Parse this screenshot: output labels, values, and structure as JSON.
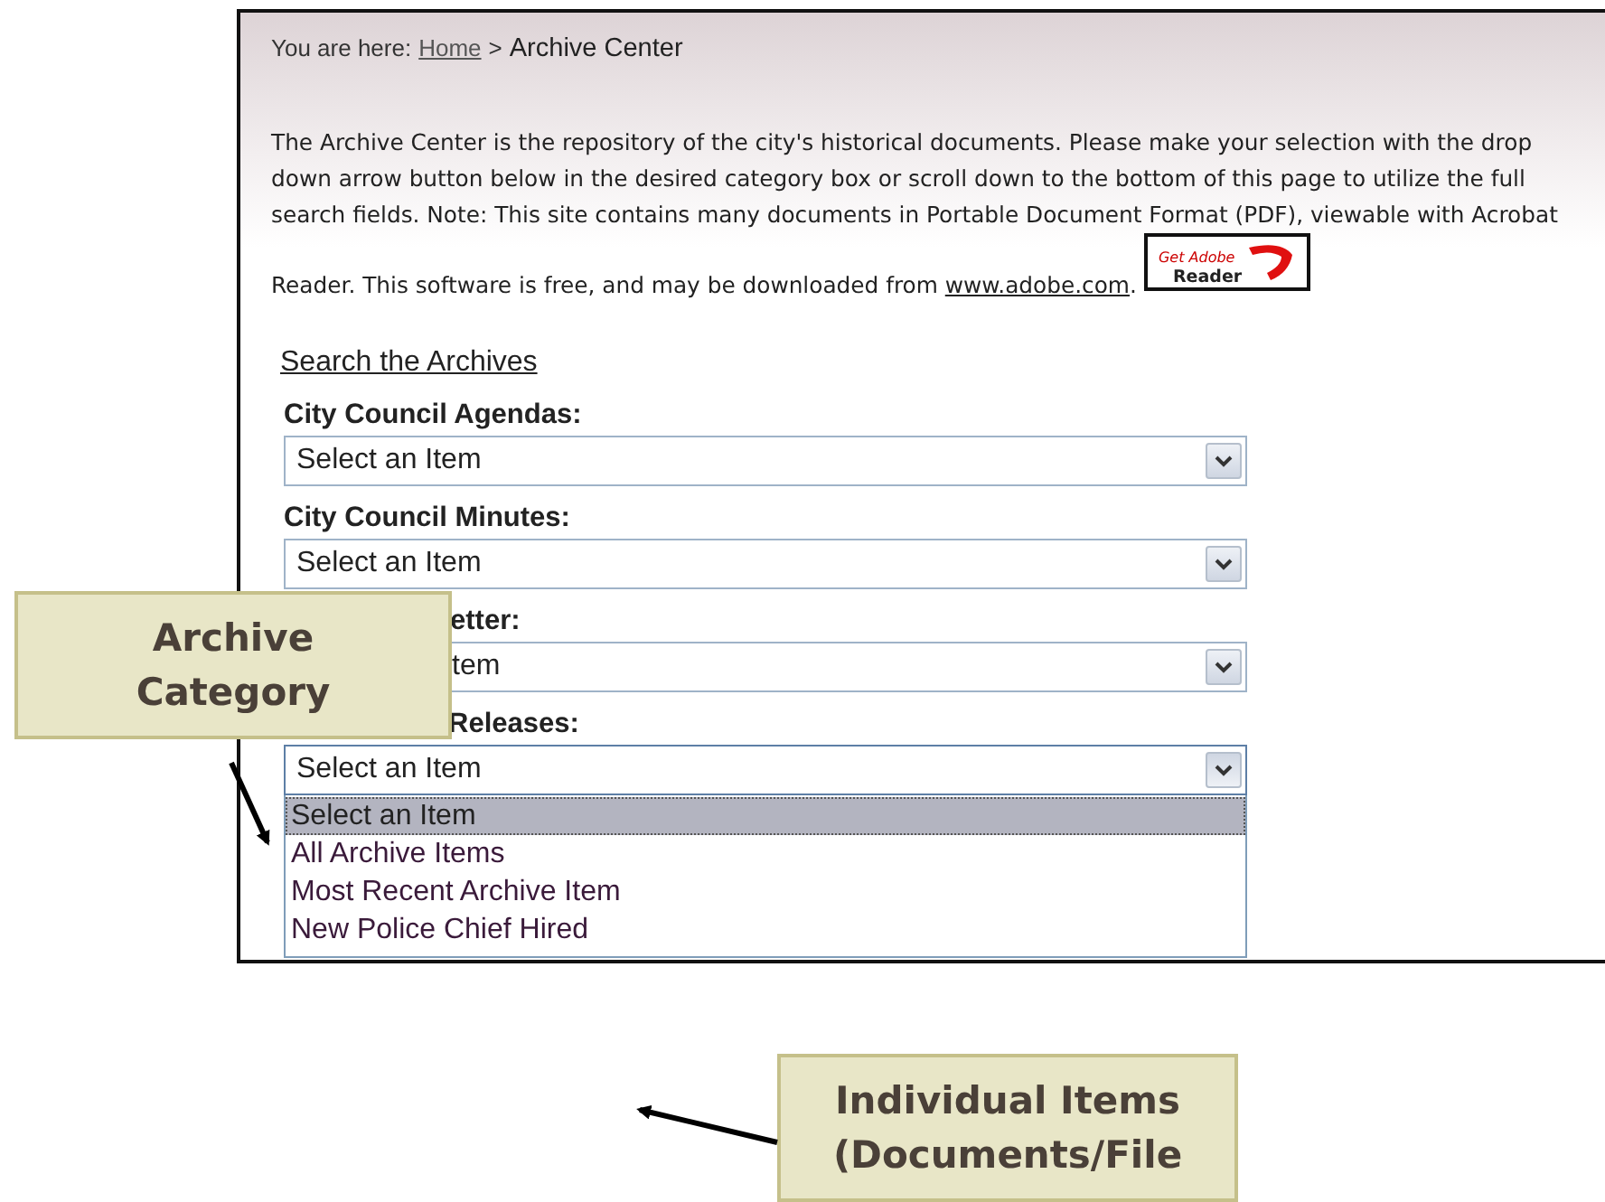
{
  "breadcrumb": {
    "prefix": "You are here:",
    "link": "Home",
    "separator": ">",
    "current": "Archive Center"
  },
  "intro": "The Archive Center is the repository of the city's historical documents. Please make your selection with the drop down arrow button below in the desired category box or scroll down to the bottom of this page to utilize the full search fields. Note: This site contains many documents in Portable Document Format (PDF), viewable with Acrobat",
  "intro_tail": {
    "text": "Reader. This software is free, and may be downloaded from",
    "link": "www.adobe.com",
    "end": "."
  },
  "adobe_badge": {
    "top": "Get Adobe",
    "bottom": "Reader"
  },
  "search_link": "Search the Archives",
  "categories": [
    {
      "label": "City Council Agendas:",
      "value": "Select an Item",
      "expanded": false
    },
    {
      "label": "City Council Minutes:",
      "value": "Select an Item",
      "expanded": false
    },
    {
      "label": "etter:",
      "value": "tem",
      "expanded": false
    },
    {
      "label": "Releases:",
      "value": "Select an Item",
      "expanded": true,
      "options": [
        {
          "label": "Select an Item",
          "selected": true
        },
        {
          "label": "All Archive Items",
          "selected": false
        },
        {
          "label": "Most Recent Archive Item",
          "selected": false
        },
        {
          "label": "New Police Chief Hired",
          "selected": false
        }
      ]
    }
  ],
  "callouts": [
    {
      "text": "Archive Category",
      "kind": "category"
    },
    {
      "text": "Individual Items (Documents/File",
      "kind": "items"
    }
  ]
}
